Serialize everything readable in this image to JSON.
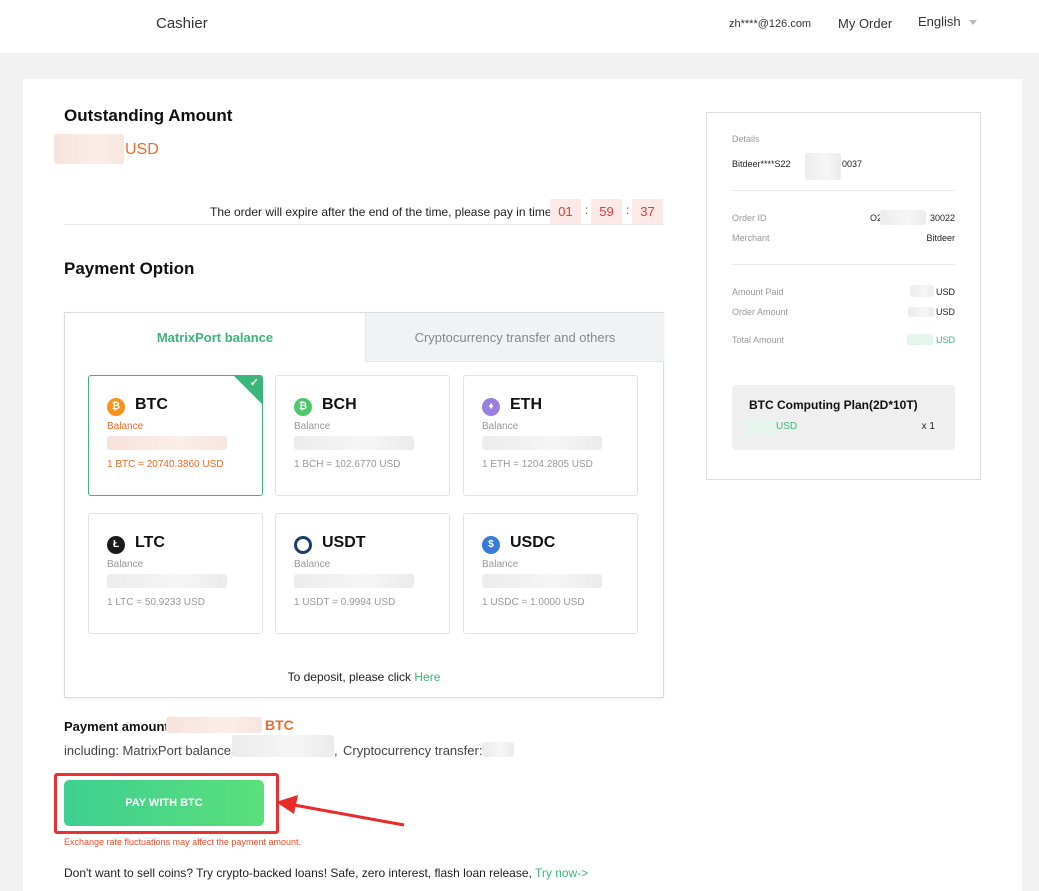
{
  "header": {
    "brand": "Cashier",
    "user_email": "zh****@126.com",
    "my_order": "My Order",
    "language": "English"
  },
  "outstanding": {
    "title": "Outstanding Amount",
    "currency": "USD"
  },
  "timer": {
    "message": "The order will expire after the end of the time, please pay in time",
    "hours": "01",
    "minutes": "59",
    "seconds": "37",
    "separator": ":"
  },
  "payment_option": {
    "title": "Payment Option",
    "tabs": [
      "MatrixPort balance",
      "Cryptocurrency transfer and others"
    ],
    "balance_label": "Balance",
    "coins": [
      {
        "symbol": "BTC",
        "icon": "₿",
        "color": "#f7931a",
        "rate": "1 BTC = 20740.3860 USD"
      },
      {
        "symbol": "BCH",
        "icon": "₿",
        "color": "#4cca6b",
        "rate": "1 BCH = 102.6770 USD"
      },
      {
        "symbol": "ETH",
        "icon": "♦",
        "color": "#9a7fe0",
        "rate": "1 ETH = 1204.2805 USD"
      },
      {
        "symbol": "LTC",
        "icon": "Ł",
        "color": "#1a1a1a",
        "rate": "1 LTC = 50.9233 USD"
      },
      {
        "symbol": "USDT",
        "icon": "",
        "color": "#1d3e6e",
        "rate": "1 USDT = 0.9994 USD"
      },
      {
        "symbol": "USDC",
        "icon": "$",
        "color": "#3b7ad8",
        "rate": "1 USDC = 1.0000 USD"
      }
    ],
    "deposit_text": "To deposit, please click ",
    "deposit_link": "Here"
  },
  "payment": {
    "amount_label": "Payment amount:",
    "currency": "BTC",
    "including_label": "including: MatrixPort balance:",
    "comma": ",",
    "crypto_transfer_label": "Cryptocurrency transfer:",
    "pay_button": "PAY WITH BTC",
    "fx_note": "Exchange rate fluctuations may affect the payment amount.",
    "promo_text": "Don't want to sell coins? Try crypto-backed loans! Safe, zero interest, flash loan release, ",
    "promo_link": "Try now->"
  },
  "details": {
    "title": "Details",
    "product": "Bitdeer****S22",
    "product_tail": "0037",
    "order_id_label": "Order ID",
    "order_id_head": "O2",
    "order_id_tail": "30022",
    "merchant_label": "Merchant",
    "merchant": "Bitdeer",
    "amount_paid_label": "Amount Paid",
    "order_amount_label": "Order Amount",
    "total_amount_label": "Total Amount",
    "usd": "USD",
    "plan_name": "BTC Computing Plan(2D*10T)",
    "plan_qty": "x 1"
  }
}
